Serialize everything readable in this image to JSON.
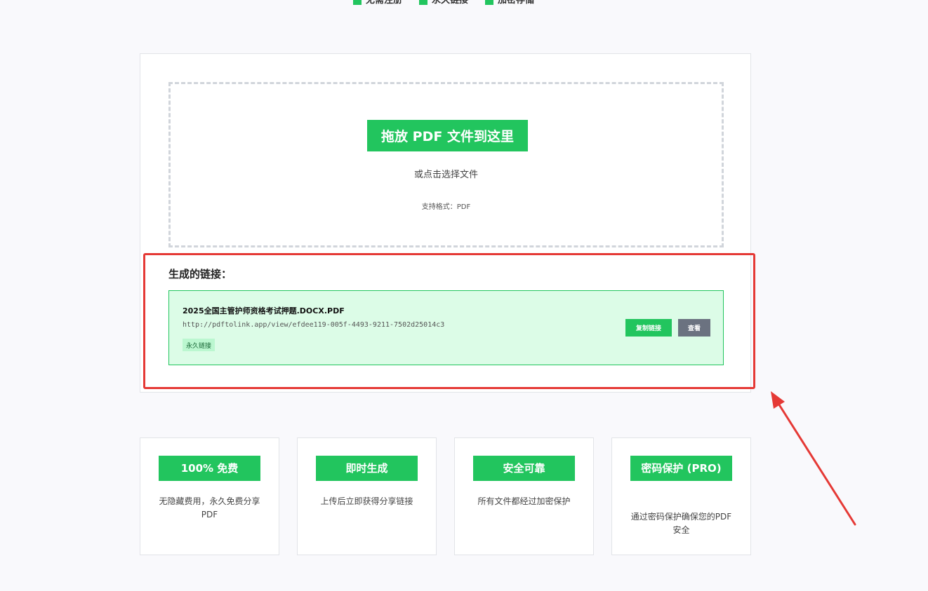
{
  "top_badges": [
    "无需注册",
    "永久链接",
    "加密存储"
  ],
  "upload": {
    "title": "拖放 PDF 文件到这里",
    "subtitle": "或点击选择文件",
    "formats": "支持格式：PDF"
  },
  "result": {
    "title": "生成的链接：",
    "file_name": "2025全国主管护师资格考试押题.DOCX.PDF",
    "url": "http://pdftolink.app/view/efdee119-005f-4493-9211-7502d25014c3",
    "tag": "永久链接",
    "copy_label": "复制链接",
    "view_label": "查看"
  },
  "features": [
    {
      "title": "100% 免费",
      "desc": "无隐藏费用，永久免费分享PDF"
    },
    {
      "title": "即时生成",
      "desc": "上传后立即获得分享链接"
    },
    {
      "title": "安全可靠",
      "desc": "所有文件都经过加密保护"
    },
    {
      "title": "密码保护 (PRO)",
      "desc": "通过密码保护确保您的PDF安全"
    }
  ],
  "colors": {
    "accent": "#22c55e",
    "annotation": "#e53935",
    "secondary_button": "#6b7280",
    "result_bg": "#dcfce7"
  }
}
